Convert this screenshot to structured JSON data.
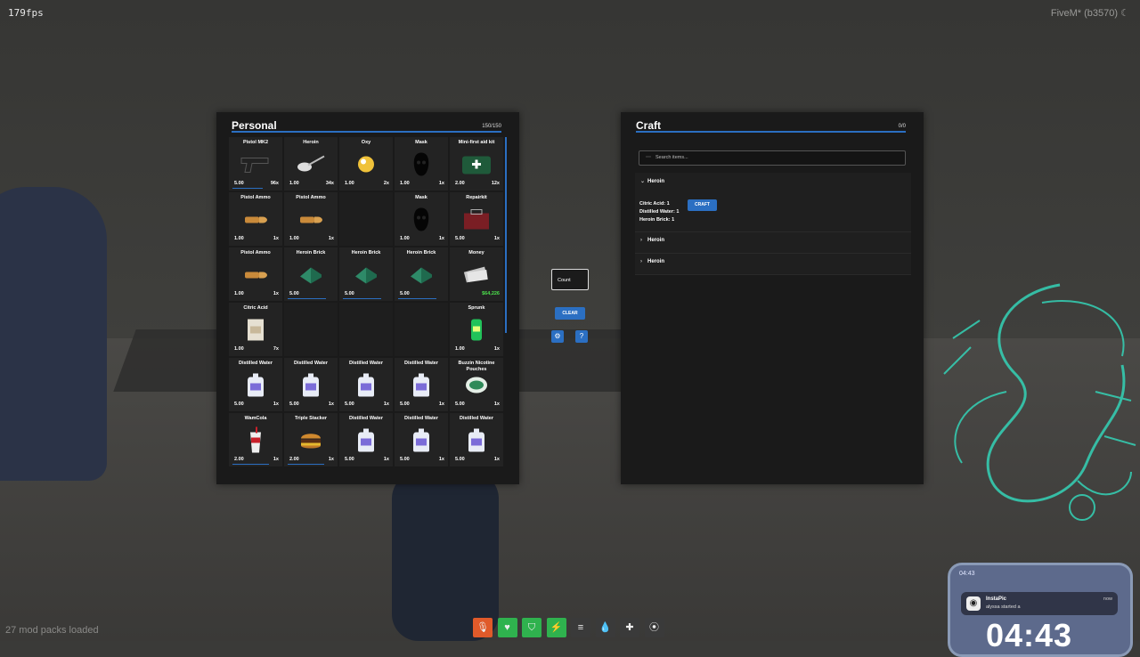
{
  "hud_overlay": {
    "fps": "179fps",
    "brand": "FiveM* (b3570)",
    "mods_loaded": "27 mod packs loaded"
  },
  "personal": {
    "title": "Personal",
    "capacity": "150/150",
    "slots": [
      {
        "name": "Pistol MK2",
        "weight": "5.00",
        "qty": "96x",
        "icon": "pistol-icon",
        "durability": 0.7
      },
      {
        "name": "Heroin",
        "weight": "1.00",
        "qty": "34x",
        "icon": "heroin-spoon-icon"
      },
      {
        "name": "Oxy",
        "weight": "1.00",
        "qty": "2x",
        "icon": "pill-icon"
      },
      {
        "name": "Mask",
        "weight": "1.00",
        "qty": "1x",
        "icon": "mask-icon"
      },
      {
        "name": "Mini-first aid kit",
        "weight": "2.00",
        "qty": "12x",
        "icon": "first-aid-icon"
      },
      {
        "name": "Pistol Ammo",
        "weight": "1.00",
        "qty": "1x",
        "icon": "bullet-icon"
      },
      {
        "name": "Pistol Ammo",
        "weight": "1.00",
        "qty": "1x",
        "icon": "bullet-icon"
      },
      {
        "name": "",
        "weight": "",
        "qty": "",
        "icon": "",
        "empty": true
      },
      {
        "name": "Mask",
        "weight": "1.00",
        "qty": "1x",
        "icon": "mask-icon"
      },
      {
        "name": "Repairkit",
        "weight": "5.00",
        "qty": "1x",
        "icon": "toolbox-icon"
      },
      {
        "name": "Pistol Ammo",
        "weight": "1.00",
        "qty": "1x",
        "icon": "bullet-icon"
      },
      {
        "name": "Heroin Brick",
        "weight": "5.00",
        "qty": "",
        "icon": "brick-icon",
        "durability": 0.9
      },
      {
        "name": "Heroin Brick",
        "weight": "5.00",
        "qty": "",
        "icon": "brick-icon",
        "durability": 0.9
      },
      {
        "name": "Heroin Brick",
        "weight": "5.00",
        "qty": "",
        "icon": "brick-icon",
        "durability": 0.9
      },
      {
        "name": "Money",
        "weight": "",
        "qty": "$64,226",
        "icon": "cash-icon",
        "money": true
      },
      {
        "name": "Citric Acid",
        "weight": "1.00",
        "qty": "7x",
        "icon": "bag-icon"
      },
      {
        "name": "",
        "weight": "",
        "qty": "",
        "icon": "",
        "empty": true
      },
      {
        "name": "",
        "weight": "",
        "qty": "",
        "icon": "",
        "empty": true
      },
      {
        "name": "",
        "weight": "",
        "qty": "",
        "icon": "",
        "empty": true
      },
      {
        "name": "Sprunk",
        "weight": "1.00",
        "qty": "1x",
        "icon": "soda-can-icon"
      },
      {
        "name": "Distilled Water",
        "weight": "5.00",
        "qty": "1x",
        "icon": "water-jug-icon"
      },
      {
        "name": "Distilled Water",
        "weight": "5.00",
        "qty": "1x",
        "icon": "water-jug-icon"
      },
      {
        "name": "Distilled Water",
        "weight": "5.00",
        "qty": "1x",
        "icon": "water-jug-icon"
      },
      {
        "name": "Distilled Water",
        "weight": "5.00",
        "qty": "1x",
        "icon": "water-jug-icon"
      },
      {
        "name": "Buzzin Nicotine Pouches",
        "weight": "5.00",
        "qty": "1x",
        "icon": "tin-icon"
      },
      {
        "name": "WamCola",
        "weight": "2.00",
        "qty": "1x",
        "icon": "cup-icon",
        "durability": 0.85
      },
      {
        "name": "Triple Stacker",
        "weight": "2.00",
        "qty": "1x",
        "icon": "burger-icon",
        "durability": 0.85
      },
      {
        "name": "Distilled Water",
        "weight": "5.00",
        "qty": "1x",
        "icon": "water-jug-icon"
      },
      {
        "name": "Distilled Water",
        "weight": "5.00",
        "qty": "1x",
        "icon": "water-jug-icon"
      },
      {
        "name": "Distilled Water",
        "weight": "5.00",
        "qty": "1x",
        "icon": "water-jug-icon"
      }
    ]
  },
  "controls": {
    "count_placeholder": "Count",
    "clear_label": "CLEAR",
    "settings_icon": "gear-icon",
    "help_icon": "question-icon"
  },
  "craft": {
    "title": "Craft",
    "capacity": "0/0",
    "search_placeholder": "Search items...",
    "recipes": [
      {
        "name": "Heroin",
        "expanded": true,
        "ingredients": [
          "Citric Acid: 1",
          "Distilled Water: 1",
          "Heroin Brick: 1"
        ],
        "button": "CRAFT"
      },
      {
        "name": "Heroin",
        "expanded": false
      },
      {
        "name": "Heroin",
        "expanded": false
      }
    ]
  },
  "status_hud": [
    {
      "icon": "microphone-icon",
      "color": "#e05a2a"
    },
    {
      "icon": "heart-icon",
      "color": "#2fb24e"
    },
    {
      "icon": "shield-icon",
      "color": "#2fb24e"
    },
    {
      "icon": "lightning-icon",
      "color": "#2fb24e"
    },
    {
      "icon": "burger-icon",
      "color": "#3a3a3a"
    },
    {
      "icon": "water-drop-icon",
      "color": "#3a3a3a"
    },
    {
      "icon": "bandage-icon",
      "color": "#3a3a3a"
    },
    {
      "icon": "pills-icon",
      "color": "#3a3a3a"
    }
  ],
  "phone": {
    "time": "04:43",
    "app": "InstaPic",
    "message": "alyssa started a",
    "when": "now",
    "clock": "04:43"
  },
  "colors": {
    "accent": "#2b6fc2",
    "money": "#4ce04c",
    "dragon": "#34d3b7"
  }
}
